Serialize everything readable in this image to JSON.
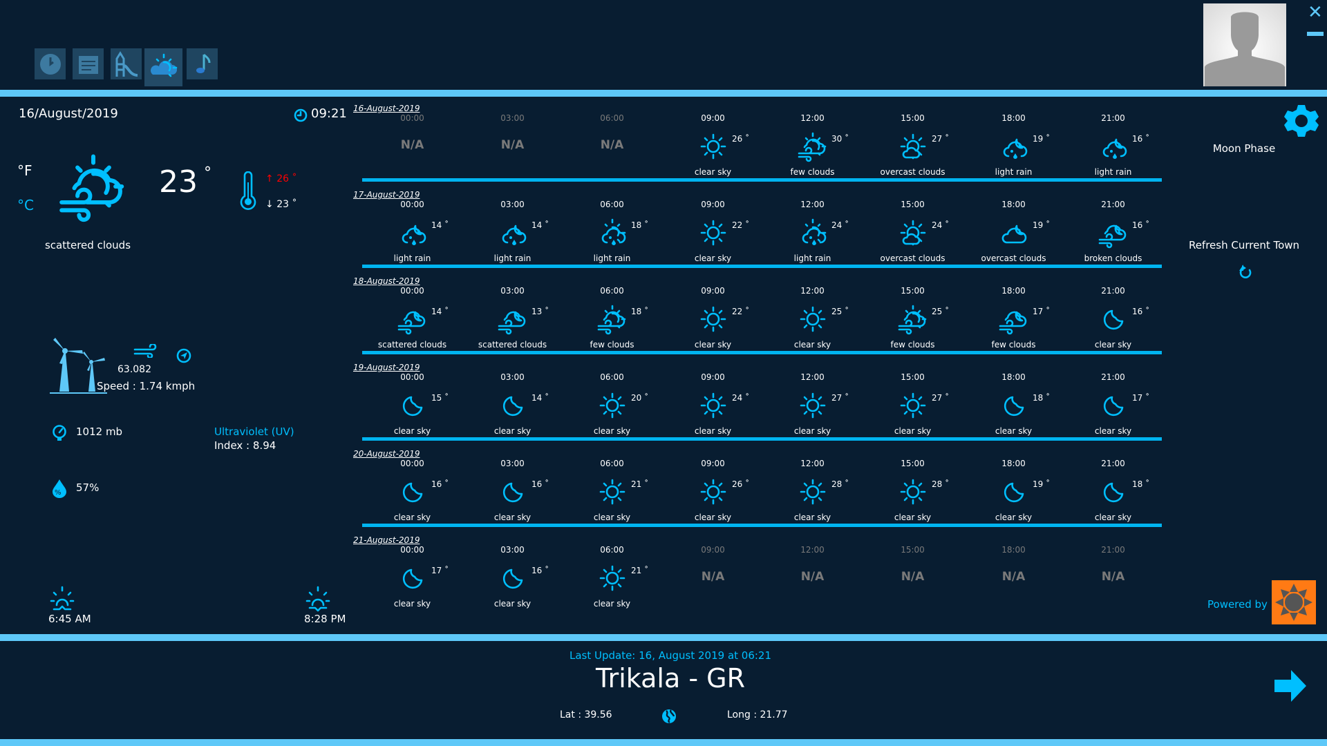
{
  "colors": {
    "background": "#081d31",
    "accent": "#00bfff",
    "bar": "#5ec8f8",
    "max_temp": "#ff0000",
    "na": "#7a7a7a"
  },
  "nav": [
    {
      "name": "clock-app",
      "icon": "clock-icon"
    },
    {
      "name": "calendar-app",
      "icon": "calendar-icon"
    },
    {
      "name": "playground-app",
      "icon": "playground-icon"
    },
    {
      "name": "weather-app",
      "icon": "weather-icon",
      "active": true
    },
    {
      "name": "music-app",
      "icon": "music-note-icon"
    }
  ],
  "current": {
    "date": "16/August/2019",
    "time": "09:21",
    "unit_f": "°F",
    "unit_c": "°C",
    "temp": "23",
    "deg": "°",
    "max": "26 ˚",
    "min": "23 ˚",
    "max_arrow": "↑",
    "min_arrow": "↓",
    "description": "scattered clouds",
    "wind_deg": "63.082",
    "wind_speed": "Speed : 1.74 kmph",
    "pressure": "1012 mb",
    "uv_label": "Ultraviolet (UV)",
    "uv_index": "Index : 8.94",
    "humidity": "57%",
    "sunrise": "6:45 AM",
    "sunset": "8:28 PM"
  },
  "right": {
    "moon_phase": "Moon Phase",
    "refresh": "Refresh Current Town",
    "powered_by": "Powered by :",
    "logo_text": "Open Weather Map"
  },
  "footer": {
    "last_update": "Last Update: 16, August 2019 at 06:21",
    "town": "Trikala - GR",
    "lat": "Lat : 39.56",
    "long": "Long : 21.77"
  },
  "forecast": [
    {
      "date": "16-August-2019",
      "cells": [
        {
          "time": "00:00",
          "na": "N/A"
        },
        {
          "time": "03:00",
          "na": "N/A"
        },
        {
          "time": "06:00",
          "na": "N/A"
        },
        {
          "time": "09:00",
          "icon": "sun",
          "temp": "26 ˚",
          "desc": "clear sky"
        },
        {
          "time": "12:00",
          "icon": "wind-cloud-sun",
          "temp": "30 ˚",
          "desc": "few clouds"
        },
        {
          "time": "15:00",
          "icon": "sun-cloud",
          "temp": "27 ˚",
          "desc": "overcast clouds"
        },
        {
          "time": "18:00",
          "icon": "rain-cloud-moon",
          "temp": "19 ˚",
          "desc": "light rain"
        },
        {
          "time": "21:00",
          "icon": "rain-cloud-moon",
          "temp": "16 ˚",
          "desc": "light rain"
        }
      ]
    },
    {
      "date": "17-August-2019",
      "cells": [
        {
          "time": "00:00",
          "icon": "rain-cloud-moon",
          "temp": "14 ˚",
          "desc": "light rain"
        },
        {
          "time": "03:00",
          "icon": "rain-cloud-moon",
          "temp": "14 ˚",
          "desc": "light rain"
        },
        {
          "time": "06:00",
          "icon": "rain-cloud-sun",
          "temp": "18 ˚",
          "desc": "light rain"
        },
        {
          "time": "09:00",
          "icon": "sun",
          "temp": "22 ˚",
          "desc": "clear sky"
        },
        {
          "time": "12:00",
          "icon": "rain-cloud-sun",
          "temp": "24 ˚",
          "desc": "light rain"
        },
        {
          "time": "15:00",
          "icon": "sun-cloud",
          "temp": "24 ˚",
          "desc": "overcast clouds"
        },
        {
          "time": "18:00",
          "icon": "cloud-moon",
          "temp": "19 ˚",
          "desc": "overcast clouds"
        },
        {
          "time": "21:00",
          "icon": "wind-cloud-moon",
          "temp": "16 ˚",
          "desc": "broken clouds"
        }
      ]
    },
    {
      "date": "18-August-2019",
      "cells": [
        {
          "time": "00:00",
          "icon": "wind-cloud-moon",
          "temp": "14 ˚",
          "desc": "scattered clouds"
        },
        {
          "time": "03:00",
          "icon": "wind-cloud-moon",
          "temp": "13 ˚",
          "desc": "scattered clouds"
        },
        {
          "time": "06:00",
          "icon": "wind-cloud-sun",
          "temp": "18 ˚",
          "desc": "few clouds"
        },
        {
          "time": "09:00",
          "icon": "sun",
          "temp": "22 ˚",
          "desc": "clear sky"
        },
        {
          "time": "12:00",
          "icon": "sun",
          "temp": "25 ˚",
          "desc": "clear sky"
        },
        {
          "time": "15:00",
          "icon": "wind-cloud-sun",
          "temp": "25 ˚",
          "desc": "few clouds"
        },
        {
          "time": "18:00",
          "icon": "wind-cloud-moon",
          "temp": "17 ˚",
          "desc": "few clouds"
        },
        {
          "time": "21:00",
          "icon": "moon",
          "temp": "16 ˚",
          "desc": "clear sky"
        }
      ]
    },
    {
      "date": "19-August-2019",
      "cells": [
        {
          "time": "00:00",
          "icon": "moon",
          "temp": "15 ˚",
          "desc": "clear sky"
        },
        {
          "time": "03:00",
          "icon": "moon",
          "temp": "14 ˚",
          "desc": "clear sky"
        },
        {
          "time": "06:00",
          "icon": "sun",
          "temp": "20 ˚",
          "desc": "clear sky"
        },
        {
          "time": "09:00",
          "icon": "sun",
          "temp": "24 ˚",
          "desc": "clear sky"
        },
        {
          "time": "12:00",
          "icon": "sun",
          "temp": "27 ˚",
          "desc": "clear sky"
        },
        {
          "time": "15:00",
          "icon": "sun",
          "temp": "27 ˚",
          "desc": "clear sky"
        },
        {
          "time": "18:00",
          "icon": "moon",
          "temp": "18 ˚",
          "desc": "clear sky"
        },
        {
          "time": "21:00",
          "icon": "moon",
          "temp": "17 ˚",
          "desc": "clear sky"
        }
      ]
    },
    {
      "date": "20-August-2019",
      "cells": [
        {
          "time": "00:00",
          "icon": "moon",
          "temp": "16 ˚",
          "desc": "clear sky"
        },
        {
          "time": "03:00",
          "icon": "moon",
          "temp": "16 ˚",
          "desc": "clear sky"
        },
        {
          "time": "06:00",
          "icon": "sun",
          "temp": "21 ˚",
          "desc": "clear sky"
        },
        {
          "time": "09:00",
          "icon": "sun",
          "temp": "26 ˚",
          "desc": "clear sky"
        },
        {
          "time": "12:00",
          "icon": "sun",
          "temp": "28 ˚",
          "desc": "clear sky"
        },
        {
          "time": "15:00",
          "icon": "sun",
          "temp": "28 ˚",
          "desc": "clear sky"
        },
        {
          "time": "18:00",
          "icon": "moon",
          "temp": "19 ˚",
          "desc": "clear sky"
        },
        {
          "time": "21:00",
          "icon": "moon",
          "temp": "18 ˚",
          "desc": "clear sky"
        }
      ]
    },
    {
      "date": "21-August-2019",
      "cells": [
        {
          "time": "00:00",
          "icon": "moon",
          "temp": "17 ˚",
          "desc": "clear sky"
        },
        {
          "time": "03:00",
          "icon": "moon",
          "temp": "16 ˚",
          "desc": "clear sky"
        },
        {
          "time": "06:00",
          "icon": "sun",
          "temp": "21 ˚",
          "desc": "clear sky"
        },
        {
          "time": "09:00",
          "na": "N/A"
        },
        {
          "time": "12:00",
          "na": "N/A"
        },
        {
          "time": "15:00",
          "na": "N/A"
        },
        {
          "time": "18:00",
          "na": "N/A"
        },
        {
          "time": "21:00",
          "na": "N/A"
        }
      ]
    }
  ]
}
